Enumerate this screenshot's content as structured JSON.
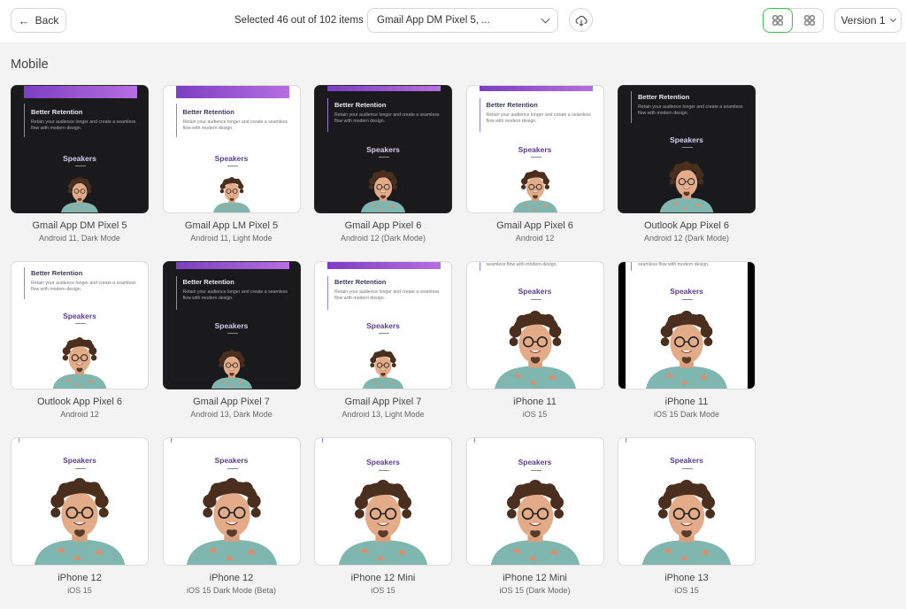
{
  "toolbar": {
    "back_label": "Back",
    "selected_text": "Selected 46 out of 102 items",
    "client_select_value": "Gmail App DM Pixel 5, ...",
    "version_label": "Version 1"
  },
  "colors": {
    "accent_active": "#3fbf5a",
    "banner_start": "#7b3fc2",
    "banner_end": "#b76ee0"
  },
  "section": {
    "title": "Mobile"
  },
  "thumb_text": {
    "headline": "Better Retention",
    "body": "Retain your audience longer and create a seamless flow with modern design.",
    "body_partial": "seamless flow with modern design.",
    "speakers": "Speakers"
  },
  "cards": [
    {
      "name": "Gmail App DM Pixel 5",
      "sub": "Android 11, Dark Mode"
    },
    {
      "name": "Gmail App LM Pixel 5",
      "sub": "Android 11, Light Mode"
    },
    {
      "name": "Gmail App Pixel 6",
      "sub": "Android 12 (Dark Mode)"
    },
    {
      "name": "Gmail App Pixel 6",
      "sub": "Android 12"
    },
    {
      "name": "Outlook App Pixel 6",
      "sub": "Android 12 (Dark Mode)"
    },
    {
      "name": "Outlook App Pixel 6",
      "sub": "Android 12"
    },
    {
      "name": "Gmail App Pixel 7",
      "sub": "Android 13, Dark Mode"
    },
    {
      "name": "Gmail App Pixel 7",
      "sub": "Android 13, Light Mode"
    },
    {
      "name": "iPhone 11",
      "sub": "iOS 15"
    },
    {
      "name": "iPhone 11",
      "sub": "iOS 15 Dark Mode"
    },
    {
      "name": "iPhone 12",
      "sub": "iOS 15"
    },
    {
      "name": "iPhone 12",
      "sub": "iOS 15 Dark Mode (Beta)"
    },
    {
      "name": "iPhone 12 Mini",
      "sub": "iOS 15"
    },
    {
      "name": "iPhone 12 Mini",
      "sub": "iOS 15 (Dark Mode)"
    },
    {
      "name": "iPhone 13",
      "sub": "iOS 15"
    }
  ]
}
